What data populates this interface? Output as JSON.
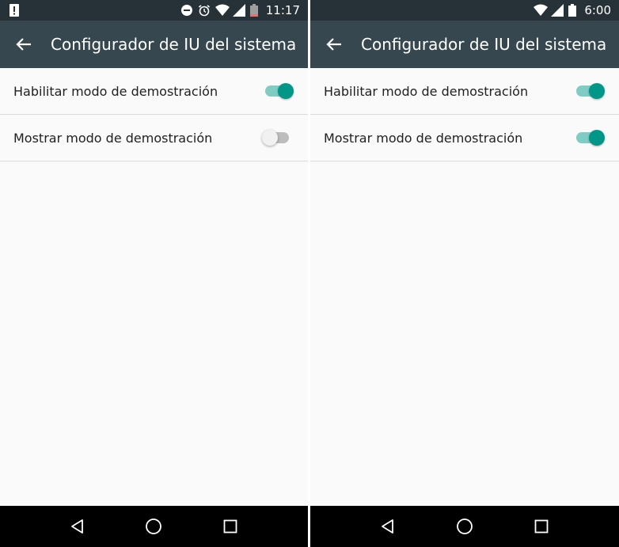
{
  "screens": [
    {
      "status_time": "11:17",
      "title": "Configurador de IU del sistema",
      "settings": [
        {
          "label": "Habilitar modo de demostración",
          "enabled": true
        },
        {
          "label": "Mostrar modo de demostración",
          "enabled": false
        }
      ]
    },
    {
      "status_time": "6:00",
      "title": "Configurador de IU del sistema",
      "settings": [
        {
          "label": "Habilitar modo de demostración",
          "enabled": true
        },
        {
          "label": "Mostrar modo de demostración",
          "enabled": true
        }
      ]
    }
  ],
  "colors": {
    "status_bar": "#263238",
    "app_bar": "#37474f",
    "accent": "#009688",
    "accent_track": "#80cbc4"
  }
}
